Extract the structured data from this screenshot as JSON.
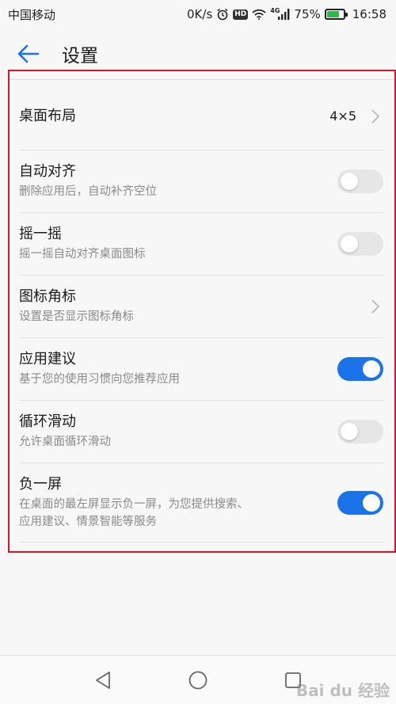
{
  "status_bar": {
    "carrier": "中国移动",
    "speed": "0K/s",
    "hd": "HD",
    "network": "4G",
    "battery": "75%",
    "time": "16:58",
    "battery_level": 0.75
  },
  "header": {
    "title": "设置"
  },
  "settings": [
    {
      "title": "桌面布局",
      "subtitle": "",
      "value": "4×5",
      "control": "chevron"
    },
    {
      "title": "自动对齐",
      "subtitle": "删除应用后，自动补齐空位",
      "control": "toggle",
      "on": false
    },
    {
      "title": "摇一摇",
      "subtitle": "摇一摇自动对齐桌面图标",
      "control": "toggle",
      "on": false
    },
    {
      "title": "图标角标",
      "subtitle": "设置是否显示图标角标",
      "control": "chevron"
    },
    {
      "title": "应用建议",
      "subtitle": "基于您的使用习惯向您推荐应用",
      "control": "toggle",
      "on": true
    },
    {
      "title": "循环滑动",
      "subtitle": "允许桌面循环滑动",
      "control": "toggle",
      "on": false
    },
    {
      "title": "负一屏",
      "subtitle_line1": "在桌面的最左屏显示负一屏，为您提供搜索、",
      "subtitle_line2": "应用建议、情景智能等服务",
      "control": "toggle",
      "on": true
    }
  ],
  "colors": {
    "accent": "#1a73e8",
    "highlight_border": "#d8142a",
    "toggle_off": "#e6e6e6"
  },
  "watermark": "Bai du 经验"
}
